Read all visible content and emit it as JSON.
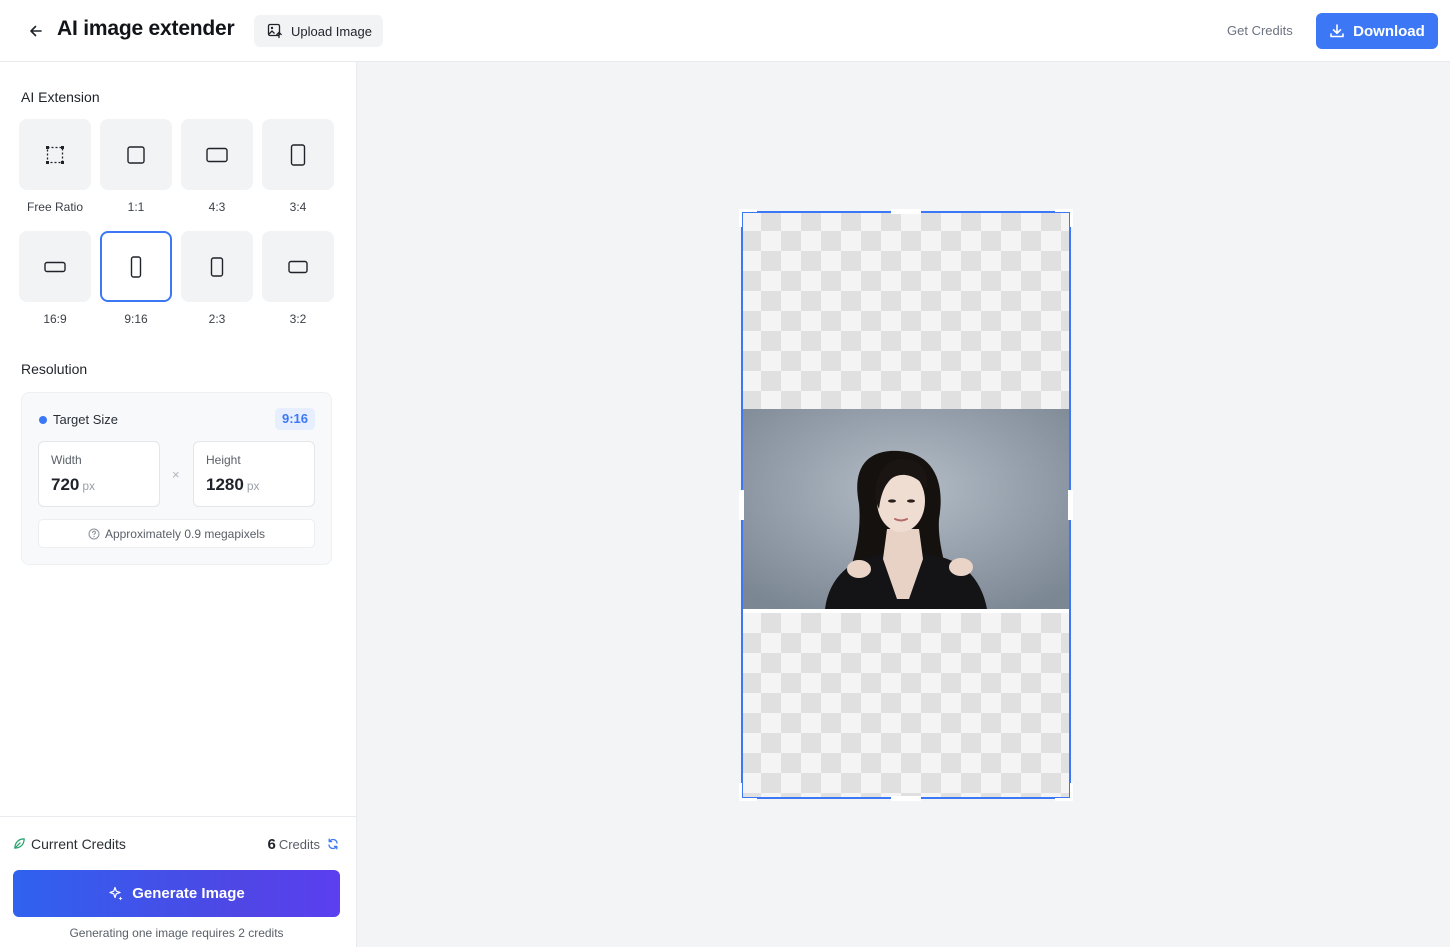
{
  "header": {
    "title": "AI image extender",
    "upload_label": "Upload Image",
    "get_credits_label": "Get Credits",
    "download_label": "Download"
  },
  "sidebar": {
    "extension_title": "AI Extension",
    "ratios": [
      {
        "label": "Free Ratio",
        "icon": "free-ratio-icon",
        "selected": false
      },
      {
        "label": "1:1",
        "icon": "square-icon",
        "selected": false
      },
      {
        "label": "4:3",
        "icon": "landscape-icon",
        "selected": false
      },
      {
        "label": "3:4",
        "icon": "portrait-icon",
        "selected": false
      },
      {
        "label": "16:9",
        "icon": "wide-icon",
        "selected": false
      },
      {
        "label": "9:16",
        "icon": "tall-icon",
        "selected": true
      },
      {
        "label": "2:3",
        "icon": "portrait-icon",
        "selected": false
      },
      {
        "label": "3:2",
        "icon": "landscape-icon",
        "selected": false
      }
    ],
    "resolution_title": "Resolution",
    "resolution": {
      "target_label": "Target Size",
      "ratio_badge": "9:16",
      "width_label": "Width",
      "width_value": "720",
      "height_label": "Height",
      "height_value": "1280",
      "unit": "px",
      "times": "×",
      "megapixels_note": "Approximately 0.9 megapixels"
    }
  },
  "footer": {
    "credits_label": "Current Credits",
    "credits_value": "6",
    "credits_unit": "Credits",
    "generate_label": "Generate Image",
    "generate_note": "Generating one image requires 2 credits"
  },
  "colors": {
    "accent": "#3c78f6",
    "generate_gradient_start": "#2f62ef",
    "generate_gradient_end": "#5b3ff0"
  }
}
